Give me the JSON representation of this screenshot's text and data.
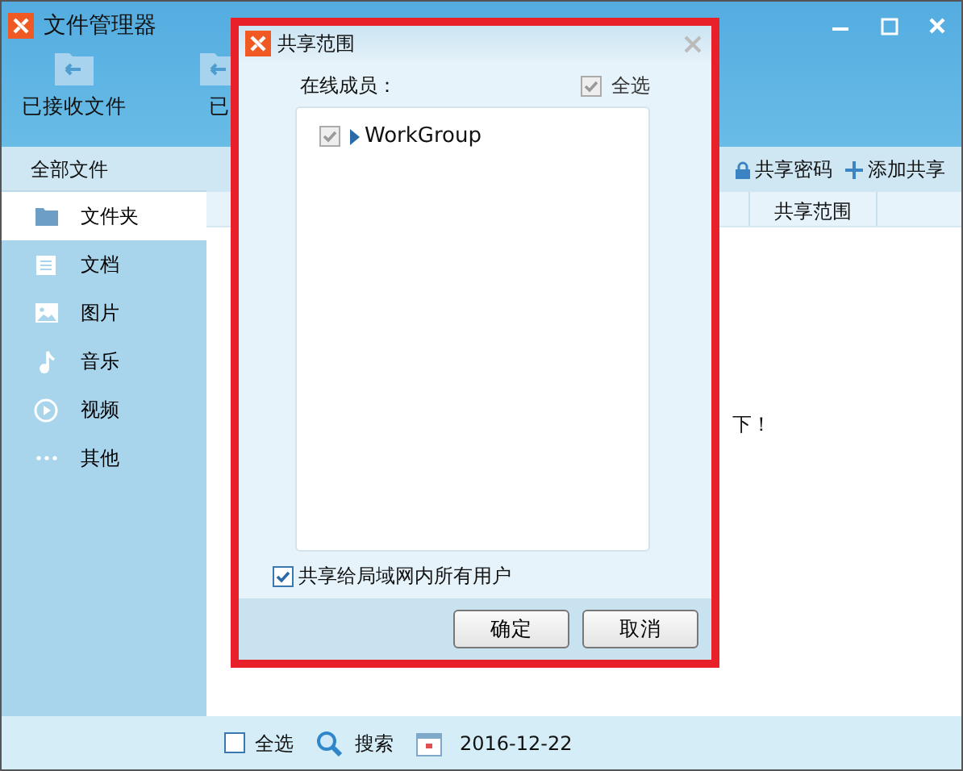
{
  "window": {
    "title": "文件管理器"
  },
  "toolbar": [
    {
      "label": "已接收文件"
    },
    {
      "label": "已"
    }
  ],
  "sidebar": {
    "header": "全部文件",
    "items": [
      {
        "label": "文件夹",
        "kind": "folder",
        "selected": true
      },
      {
        "label": "文档",
        "kind": "document",
        "selected": false
      },
      {
        "label": "图片",
        "kind": "image",
        "selected": false
      },
      {
        "label": "音乐",
        "kind": "music",
        "selected": false
      },
      {
        "label": "视频",
        "kind": "video",
        "selected": false
      },
      {
        "label": "其他",
        "kind": "more",
        "selected": false
      }
    ]
  },
  "content": {
    "actions": [
      {
        "label": "共享密码",
        "kind": "lock"
      },
      {
        "label": "添加共享",
        "kind": "plus"
      }
    ],
    "columns": [
      "共享范围"
    ],
    "message": "下！"
  },
  "bottom_bar": {
    "select_all": {
      "label": "全选",
      "checked": false
    },
    "search": "搜索",
    "date": "2016-12-22"
  },
  "dialog": {
    "title": "共享范围",
    "members_label": "在线成员：",
    "select_all": {
      "label": "全选",
      "checked": true,
      "disabled": true
    },
    "tree": [
      {
        "label": "WorkGroup",
        "checked": true,
        "disabled": true,
        "expanded": false
      }
    ],
    "share_all": {
      "label": "共享给局域网内所有用户",
      "checked": true
    },
    "buttons": [
      "确定",
      "取消"
    ]
  }
}
